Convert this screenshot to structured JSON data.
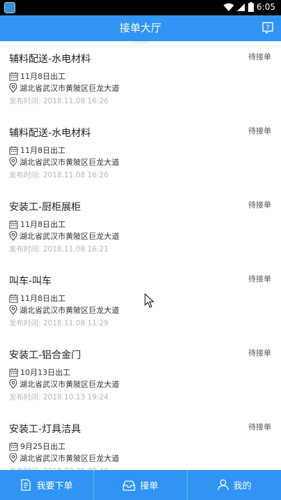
{
  "status_bar": {
    "time": "6:05"
  },
  "header": {
    "title": "接单大厅",
    "help_icon": "question-bubble-icon"
  },
  "orders": [
    {
      "title": "辅料配送-水电材料",
      "status": "待接单",
      "date": "11月8日出工",
      "address": "湖北省武汉市黄陂区巨龙大道",
      "published": "发布时间: 2018.11.08 16:26"
    },
    {
      "title": "辅料配送-水电材料",
      "status": "待接单",
      "date": "11月8日出工",
      "address": "湖北省武汉市黄陂区巨龙大道",
      "published": "发布时间: 2018.11.08 16:26"
    },
    {
      "title": "安装工-厨柜展柜",
      "status": "待接单",
      "date": "11月8日出工",
      "address": "湖北省武汉市黄陂区巨龙大道",
      "published": "发布时间: 2018.11.08 16:21"
    },
    {
      "title": "叫车-叫车",
      "status": "待接单",
      "date": "11月8日出工",
      "address": "湖北省武汉市黄陂区巨龙大道",
      "published": "发布时间: 2018.11.08 11:29"
    },
    {
      "title": "安装工-铝合金门",
      "status": "待接单",
      "date": "10月13日出工",
      "address": "湖北省武汉市黄陂区巨龙大道",
      "published": "发布时间: 2018.10.13 19:24"
    },
    {
      "title": "安装工-灯具洁具",
      "status": "待接单",
      "date": "9月25日出工",
      "address": "湖北省武汉市黄陂区巨龙大道",
      "published": "发布时间: 2018.09.25 08:46"
    }
  ],
  "tabbar": {
    "items": [
      {
        "label": "我要下单",
        "icon": "order-form-icon"
      },
      {
        "label": "接单",
        "icon": "inbox-icon"
      },
      {
        "label": "我的",
        "icon": "person-icon"
      }
    ]
  },
  "colors": {
    "brand": "#2f94f3",
    "published_text": "#b9b9b9"
  }
}
